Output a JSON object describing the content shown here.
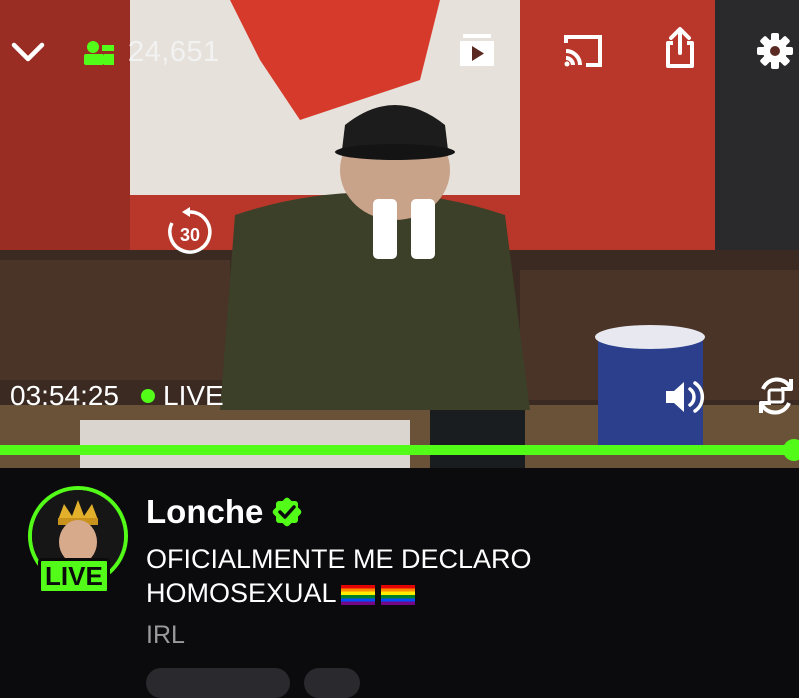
{
  "player": {
    "viewer_count": "24,651",
    "elapsed_time": "03:54:25",
    "live_label": "LIVE",
    "rewind_seconds": "30",
    "progress": 1.0,
    "icons": [
      "chevron-down-icon",
      "viewers-icon",
      "theater-mode-icon",
      "cast-icon",
      "share-icon",
      "settings-icon",
      "rewind-30-icon",
      "pause-icon",
      "volume-icon",
      "rotate-icon"
    ],
    "accent_color": "#53fc18"
  },
  "stream": {
    "channel_name": "Lonche",
    "verified": true,
    "avatar_badge": "LIVE",
    "title_line1": "OFICIALMENTE ME DECLARO",
    "title_line2": "HOMOSEXUAL",
    "category": "IRL"
  }
}
